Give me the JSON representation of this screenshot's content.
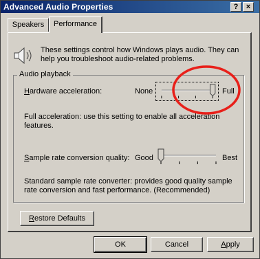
{
  "window": {
    "title": "Advanced Audio Properties",
    "help_label": "?",
    "close_label": "×"
  },
  "tabs": [
    {
      "label": "Speakers",
      "active": false
    },
    {
      "label": "Performance",
      "active": true
    }
  ],
  "info": {
    "text": "These settings control how Windows plays audio. They can help you troubleshoot audio-related problems.",
    "icon": "speaker-icon"
  },
  "audio_playback": {
    "legend": "Audio playback",
    "hardware_acceleration": {
      "label_prefix": "H",
      "label_rest": "ardware acceleration:",
      "min_label": "None",
      "max_label": "Full",
      "level_fraction": 1.0,
      "description": "Full acceleration: use this setting to enable all acceleration features."
    },
    "sample_rate": {
      "label_prefix": "S",
      "label_rest": "ample rate conversion quality:",
      "min_label": "Good",
      "max_label": "Best",
      "level_fraction": 0.0,
      "description": "Standard sample rate converter:  provides good quality sample rate conversion and fast performance. (Recommended)"
    }
  },
  "buttons": {
    "restore_prefix": "R",
    "restore_rest": "estore Defaults",
    "ok": "OK",
    "cancel": "Cancel",
    "apply_prefix": "A",
    "apply_rest": "pply"
  },
  "annotation": {
    "circle_color": "#e8201a"
  },
  "colors": {
    "titlebar_start": "#0a246a",
    "titlebar_end": "#3a6ea5",
    "face": "#d4d0c8"
  }
}
